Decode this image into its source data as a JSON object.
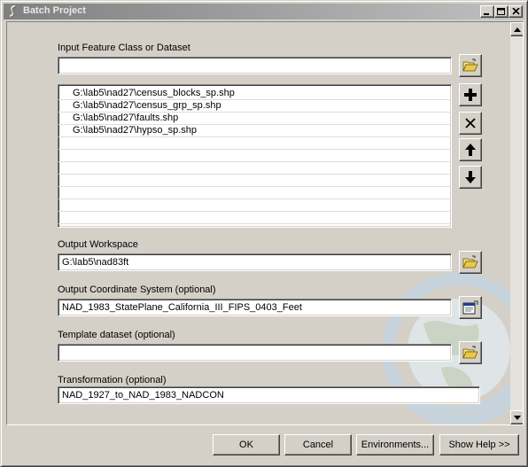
{
  "window": {
    "title": "Batch Project",
    "app_icon": "toolbox-icon",
    "controls": [
      "minimize-icon",
      "maximize-icon",
      "close-icon"
    ]
  },
  "input": {
    "label": "Input Feature Class or Dataset",
    "value": "",
    "items": [
      "G:\\lab5\\nad27\\census_blocks_sp.shp",
      "G:\\lab5\\nad27\\census_grp_sp.shp",
      "G:\\lab5\\nad27\\faults.shp",
      "G:\\lab5\\nad27\\hypso_sp.shp"
    ],
    "side_buttons": [
      "add-icon",
      "remove-icon",
      "move-up-icon",
      "move-down-icon"
    ]
  },
  "output_workspace": {
    "label": "Output Workspace",
    "value": "G:\\lab5\\nad83ft"
  },
  "output_coordinate_system": {
    "label": "Output Coordinate System (optional)",
    "value": "NAD_1983_StatePlane_California_III_FIPS_0403_Feet"
  },
  "template_dataset": {
    "label": "Template dataset (optional)",
    "value": ""
  },
  "transformation": {
    "label": "Transformation (optional)",
    "value": "NAD_1927_to_NAD_1983_NADCON"
  },
  "buttons": {
    "ok": "OK",
    "cancel": "Cancel",
    "environments": "Environments...",
    "show_help": "Show Help >>"
  },
  "colors": {
    "face": "#d4d0c8",
    "title_start": "#808080",
    "title_end": "#c0c0c0",
    "icon_blue": "#1c3f94"
  }
}
